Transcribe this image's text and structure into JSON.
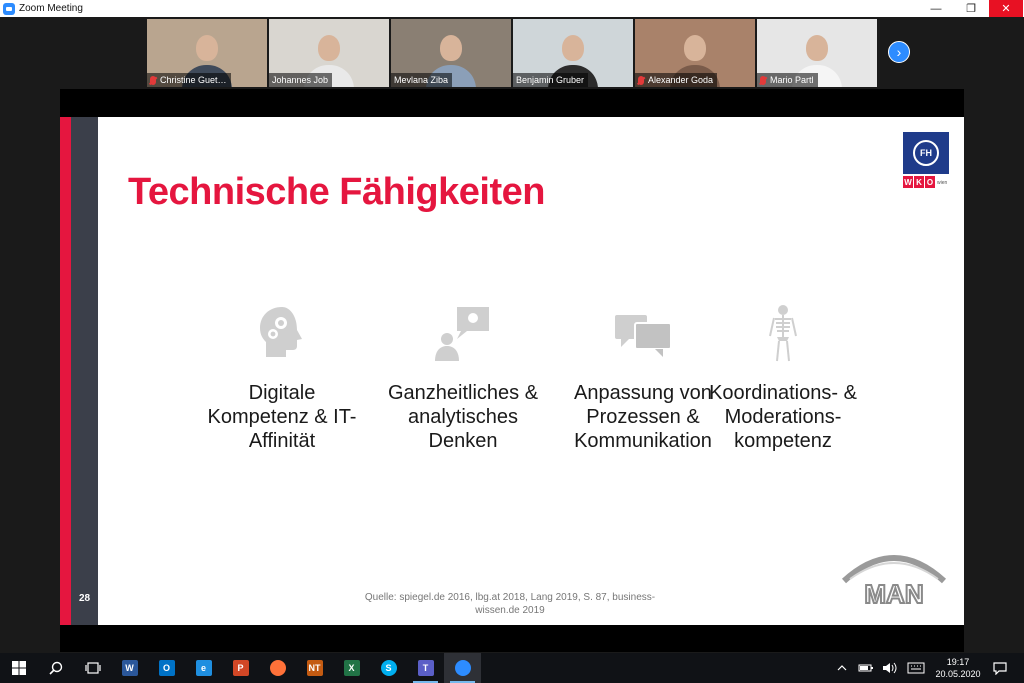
{
  "window": {
    "title": "Zoom Meeting",
    "min_glyph": "—",
    "max_glyph": "❐",
    "close_glyph": "✕"
  },
  "participants": [
    {
      "name": "Christine Guet…",
      "muted": true,
      "bg": "#b9a58f",
      "torso": "#3f4a5a",
      "active": false
    },
    {
      "name": "Johannes Job",
      "muted": false,
      "bg": "#d9d6d0",
      "torso": "#e9e9e9",
      "active": false
    },
    {
      "name": "Mevlana Ziba",
      "muted": false,
      "bg": "#8a7f73",
      "torso": "#8b9fb8",
      "active": true
    },
    {
      "name": "Benjamin Gruber",
      "muted": false,
      "bg": "#cfd6d9",
      "torso": "#2b2b2b",
      "active": false
    },
    {
      "name": "Alexander Goda",
      "muted": true,
      "bg": "#a9826a",
      "torso": "#7a5b4a",
      "active": false
    },
    {
      "name": "Mario Partl",
      "muted": true,
      "bg": "#e6e6e6",
      "torso": "#f5f5f5",
      "active": false
    }
  ],
  "gallery_next_glyph": "›",
  "slide": {
    "title": "Technische Fähigkeiten",
    "page_number": "28",
    "fh_logo_text": "FH",
    "wko_letters": [
      "W",
      "K",
      "O"
    ],
    "wko_sub": "wien",
    "features": [
      {
        "icon": "head-gears-icon",
        "label": "Digitale Kompetenz & IT-Affinität"
      },
      {
        "icon": "person-idea-icon",
        "label": "Ganzheitliches & analytisches Denken"
      },
      {
        "icon": "chat-bubbles-icon",
        "label": "Anpassung von Prozessen & Kommunikation"
      },
      {
        "icon": "skeleton-icon",
        "label": "Koordinations- & Moderations-kompetenz"
      }
    ],
    "source": "Quelle: spiegel.de 2016, lbg.at 2018, Lang 2019, S. 87, business-wissen.de 2019",
    "man_logo_text": "MAN"
  },
  "taskbar": {
    "apps": [
      {
        "name": "word-icon",
        "letter": "W",
        "color": "#2b579a"
      },
      {
        "name": "outlook-icon",
        "letter": "O",
        "color": "#0072c6"
      },
      {
        "name": "edge-icon",
        "letter": "e",
        "color": "#1f8fe0"
      },
      {
        "name": "powerpoint-icon",
        "letter": "P",
        "color": "#d24726"
      },
      {
        "name": "firefox-icon",
        "letter": "",
        "color": "#ff7139"
      },
      {
        "name": "nero-icon",
        "letter": "NT",
        "color": "#c45b12"
      },
      {
        "name": "excel-icon",
        "letter": "X",
        "color": "#217346"
      },
      {
        "name": "skype-icon",
        "letter": "S",
        "color": "#00aff0"
      },
      {
        "name": "teams-icon",
        "letter": "T",
        "color": "#5b5fc7"
      },
      {
        "name": "zoom-icon",
        "letter": "",
        "color": "#2d8cff"
      }
    ],
    "time": "19:17",
    "date": "20.05.2020"
  }
}
